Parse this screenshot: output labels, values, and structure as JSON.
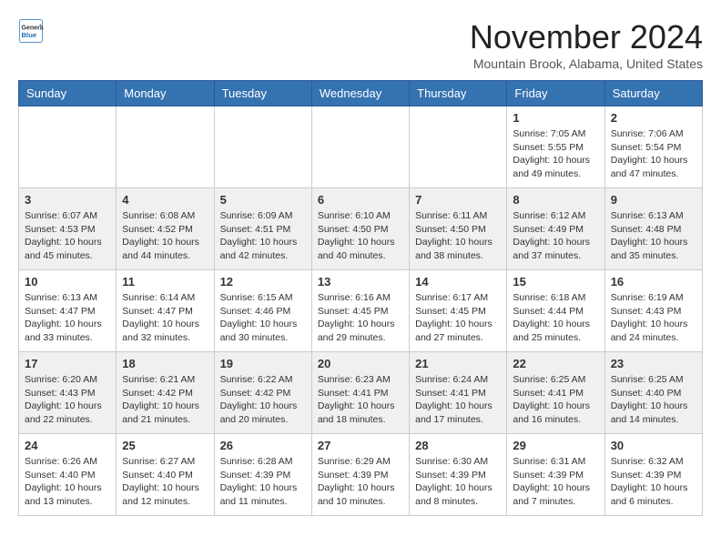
{
  "header": {
    "logo": {
      "line1": "General",
      "line2": "Blue"
    },
    "title": "November 2024",
    "location": "Mountain Brook, Alabama, United States"
  },
  "calendar": {
    "days_of_week": [
      "Sunday",
      "Monday",
      "Tuesday",
      "Wednesday",
      "Thursday",
      "Friday",
      "Saturday"
    ],
    "weeks": [
      [
        {
          "day": "",
          "info": ""
        },
        {
          "day": "",
          "info": ""
        },
        {
          "day": "",
          "info": ""
        },
        {
          "day": "",
          "info": ""
        },
        {
          "day": "",
          "info": ""
        },
        {
          "day": "1",
          "info": "Sunrise: 7:05 AM\nSunset: 5:55 PM\nDaylight: 10 hours\nand 49 minutes."
        },
        {
          "day": "2",
          "info": "Sunrise: 7:06 AM\nSunset: 5:54 PM\nDaylight: 10 hours\nand 47 minutes."
        }
      ],
      [
        {
          "day": "3",
          "info": "Sunrise: 6:07 AM\nSunset: 4:53 PM\nDaylight: 10 hours\nand 45 minutes."
        },
        {
          "day": "4",
          "info": "Sunrise: 6:08 AM\nSunset: 4:52 PM\nDaylight: 10 hours\nand 44 minutes."
        },
        {
          "day": "5",
          "info": "Sunrise: 6:09 AM\nSunset: 4:51 PM\nDaylight: 10 hours\nand 42 minutes."
        },
        {
          "day": "6",
          "info": "Sunrise: 6:10 AM\nSunset: 4:50 PM\nDaylight: 10 hours\nand 40 minutes."
        },
        {
          "day": "7",
          "info": "Sunrise: 6:11 AM\nSunset: 4:50 PM\nDaylight: 10 hours\nand 38 minutes."
        },
        {
          "day": "8",
          "info": "Sunrise: 6:12 AM\nSunset: 4:49 PM\nDaylight: 10 hours\nand 37 minutes."
        },
        {
          "day": "9",
          "info": "Sunrise: 6:13 AM\nSunset: 4:48 PM\nDaylight: 10 hours\nand 35 minutes."
        }
      ],
      [
        {
          "day": "10",
          "info": "Sunrise: 6:13 AM\nSunset: 4:47 PM\nDaylight: 10 hours\nand 33 minutes."
        },
        {
          "day": "11",
          "info": "Sunrise: 6:14 AM\nSunset: 4:47 PM\nDaylight: 10 hours\nand 32 minutes."
        },
        {
          "day": "12",
          "info": "Sunrise: 6:15 AM\nSunset: 4:46 PM\nDaylight: 10 hours\nand 30 minutes."
        },
        {
          "day": "13",
          "info": "Sunrise: 6:16 AM\nSunset: 4:45 PM\nDaylight: 10 hours\nand 29 minutes."
        },
        {
          "day": "14",
          "info": "Sunrise: 6:17 AM\nSunset: 4:45 PM\nDaylight: 10 hours\nand 27 minutes."
        },
        {
          "day": "15",
          "info": "Sunrise: 6:18 AM\nSunset: 4:44 PM\nDaylight: 10 hours\nand 25 minutes."
        },
        {
          "day": "16",
          "info": "Sunrise: 6:19 AM\nSunset: 4:43 PM\nDaylight: 10 hours\nand 24 minutes."
        }
      ],
      [
        {
          "day": "17",
          "info": "Sunrise: 6:20 AM\nSunset: 4:43 PM\nDaylight: 10 hours\nand 22 minutes."
        },
        {
          "day": "18",
          "info": "Sunrise: 6:21 AM\nSunset: 4:42 PM\nDaylight: 10 hours\nand 21 minutes."
        },
        {
          "day": "19",
          "info": "Sunrise: 6:22 AM\nSunset: 4:42 PM\nDaylight: 10 hours\nand 20 minutes."
        },
        {
          "day": "20",
          "info": "Sunrise: 6:23 AM\nSunset: 4:41 PM\nDaylight: 10 hours\nand 18 minutes."
        },
        {
          "day": "21",
          "info": "Sunrise: 6:24 AM\nSunset: 4:41 PM\nDaylight: 10 hours\nand 17 minutes."
        },
        {
          "day": "22",
          "info": "Sunrise: 6:25 AM\nSunset: 4:41 PM\nDaylight: 10 hours\nand 16 minutes."
        },
        {
          "day": "23",
          "info": "Sunrise: 6:25 AM\nSunset: 4:40 PM\nDaylight: 10 hours\nand 14 minutes."
        }
      ],
      [
        {
          "day": "24",
          "info": "Sunrise: 6:26 AM\nSunset: 4:40 PM\nDaylight: 10 hours\nand 13 minutes."
        },
        {
          "day": "25",
          "info": "Sunrise: 6:27 AM\nSunset: 4:40 PM\nDaylight: 10 hours\nand 12 minutes."
        },
        {
          "day": "26",
          "info": "Sunrise: 6:28 AM\nSunset: 4:39 PM\nDaylight: 10 hours\nand 11 minutes."
        },
        {
          "day": "27",
          "info": "Sunrise: 6:29 AM\nSunset: 4:39 PM\nDaylight: 10 hours\nand 10 minutes."
        },
        {
          "day": "28",
          "info": "Sunrise: 6:30 AM\nSunset: 4:39 PM\nDaylight: 10 hours\nand 8 minutes."
        },
        {
          "day": "29",
          "info": "Sunrise: 6:31 AM\nSunset: 4:39 PM\nDaylight: 10 hours\nand 7 minutes."
        },
        {
          "day": "30",
          "info": "Sunrise: 6:32 AM\nSunset: 4:39 PM\nDaylight: 10 hours\nand 6 minutes."
        }
      ]
    ]
  }
}
